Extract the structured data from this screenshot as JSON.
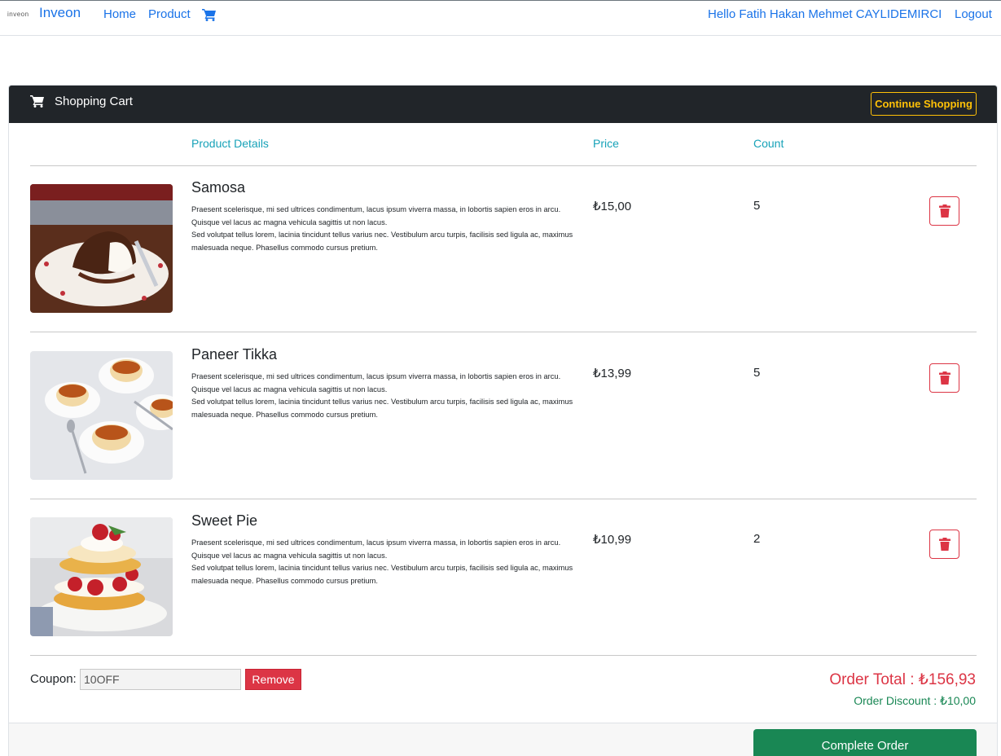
{
  "navbar": {
    "logo_text": "inveon",
    "brand": "Inveon",
    "home": "Home",
    "product": "Product",
    "cart_icon": "shopping-cart-icon",
    "greeting": "Hello Fatih Hakan Mehmet CAYLIDEMIRCI",
    "logout": "Logout"
  },
  "cart": {
    "title": "Shopping Cart",
    "continue_label": "Continue Shopping",
    "columns": {
      "details": "Product Details",
      "price": "Price",
      "count": "Count"
    },
    "items": [
      {
        "name": "Samosa",
        "desc1": "Praesent scelerisque, mi sed ultrices condimentum, lacus ipsum viverra massa, in lobortis sapien eros in arcu. Quisque vel lacus ac magna vehicula sagittis ut non lacus.",
        "desc2": "Sed volutpat tellus lorem, lacinia tincidunt tellus varius nec. Vestibulum arcu turpis, facilisis sed ligula ac, maximus malesuada neque. Phasellus commodo cursus pretium.",
        "price": "₺15,00",
        "count": "5",
        "image": "chocolate-lava-cake"
      },
      {
        "name": "Paneer Tikka",
        "desc1": "Praesent scelerisque, mi sed ultrices condimentum, lacus ipsum viverra massa, in lobortis sapien eros in arcu. Quisque vel lacus ac magna vehicula sagittis ut non lacus.",
        "desc2": "Sed volutpat tellus lorem, lacinia tincidunt tellus varius nec. Vestibulum arcu turpis, facilisis sed ligula ac, maximus malesuada neque. Phasellus commodo cursus pretium.",
        "price": "₺13,99",
        "count": "5",
        "image": "caramel-flan"
      },
      {
        "name": "Sweet Pie",
        "desc1": "Praesent scelerisque, mi sed ultrices condimentum, lacus ipsum viverra massa, in lobortis sapien eros in arcu. Quisque vel lacus ac magna vehicula sagittis ut non lacus.",
        "desc2": "Sed volutpat tellus lorem, lacinia tincidunt tellus varius nec. Vestibulum arcu turpis, facilisis sed ligula ac, maximus malesuada neque. Phasellus commodo cursus pretium.",
        "price": "₺10,99",
        "count": "2",
        "image": "strawberry-shortcake"
      }
    ],
    "coupon": {
      "label": "Coupon:",
      "value": "10OFF",
      "remove_label": "Remove"
    },
    "order_total": "Order Total : ₺156,93",
    "order_discount": "Order Discount : ₺10,00",
    "complete_label": "Complete Order"
  },
  "colors": {
    "link": "#1a73e8",
    "header_bg": "#212529",
    "accent_warning": "#ffc107",
    "column_header": "#17a2b8",
    "danger": "#dc3545",
    "success": "#198754"
  }
}
